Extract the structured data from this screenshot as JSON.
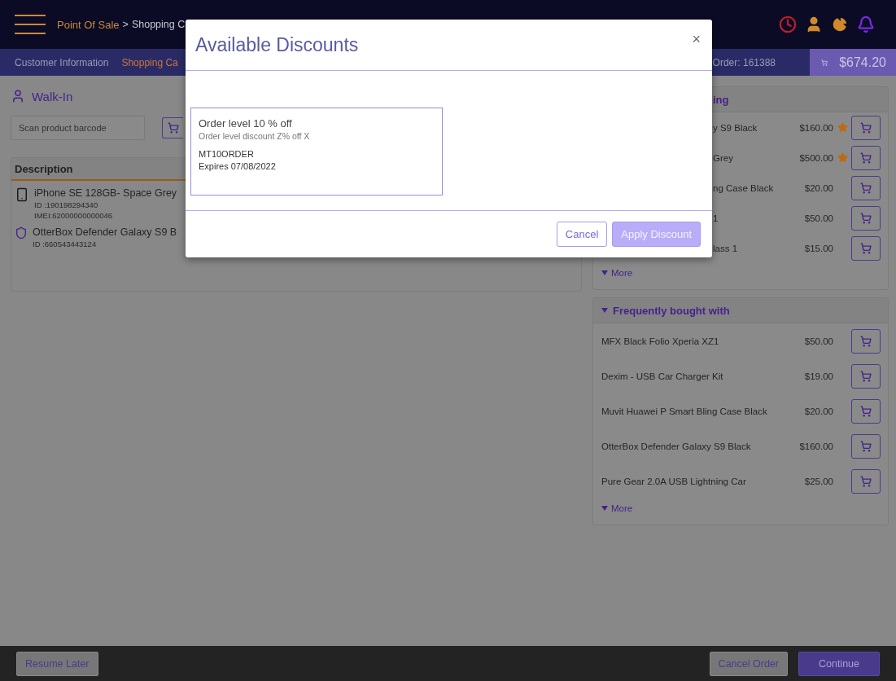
{
  "header": {
    "breadcrumb_root": "Point Of Sale",
    "separator": ">",
    "breadcrumb_current": "Shopping C"
  },
  "nav": {
    "tabs": [
      {
        "label": "Customer Information",
        "selected": false
      },
      {
        "label": "Shopping Ca",
        "selected": true
      }
    ],
    "order": "Order: 161388",
    "cart_total": "$674.20"
  },
  "customer": {
    "name": "Walk-In"
  },
  "scan": {
    "placeholder": "Scan product barcode"
  },
  "cart_table": {
    "column": "Description",
    "items": [
      {
        "kind": "phone",
        "name": "iPhone SE 128GB- Space Grey",
        "details": [
          "ID :190198294340",
          "IMEI:62000000000046"
        ]
      },
      {
        "kind": "accessory",
        "name": "OtterBox Defender Galaxy S9 B",
        "details": [
          "ID :660543443124"
        ]
      }
    ]
  },
  "sections": [
    {
      "title": "ing",
      "items": [
        {
          "name": "y S9 Black",
          "price": "$160.00",
          "featured": true
        },
        {
          "name": "Grey",
          "price": "$500.00",
          "featured": true
        },
        {
          "name": "ng Case Black",
          "price": "$20.00",
          "featured": false
        },
        {
          "name": "1",
          "price": "$50.00",
          "featured": false
        },
        {
          "name": "lass 1",
          "price": "$15.00",
          "featured": false
        }
      ],
      "more": "More"
    },
    {
      "title": "Frequently bought with",
      "expanded": true,
      "items": [
        {
          "name": "MFX Black Folio Xperia XZ1",
          "price": "$50.00",
          "featured": false
        },
        {
          "name": "Dexim - USB Car Charger Kit",
          "price": "$19.00",
          "featured": false
        },
        {
          "name": "Muvit Huawei P Smart Bling Case Black",
          "price": "$20.00",
          "featured": false
        },
        {
          "name": "OtterBox Defender Galaxy S9 Black",
          "price": "$160.00",
          "featured": false
        },
        {
          "name": "Pure Gear 2.0A USB Lightning Car",
          "price": "$25.00",
          "featured": false
        }
      ],
      "more": "More"
    }
  ],
  "footer": {
    "buttons": [
      {
        "label": "Resume Later",
        "kind": "secondary"
      },
      {
        "label": "Cancel Order",
        "kind": "secondary"
      },
      {
        "label": "Continue",
        "kind": "primary"
      }
    ]
  },
  "dialog": {
    "title": "Available Discounts",
    "close": "×",
    "discounts": [
      {
        "name": "Order level 10 % off",
        "description": "Order level discount Z% off X",
        "code": "MT10ORDER",
        "expires": "Expires 07/08/2022"
      }
    ],
    "buttons": [
      {
        "label": "Cancel",
        "kind": "secondary",
        "disabled": false
      },
      {
        "label": "Apply Discount",
        "kind": "primary",
        "disabled": true
      }
    ]
  }
}
